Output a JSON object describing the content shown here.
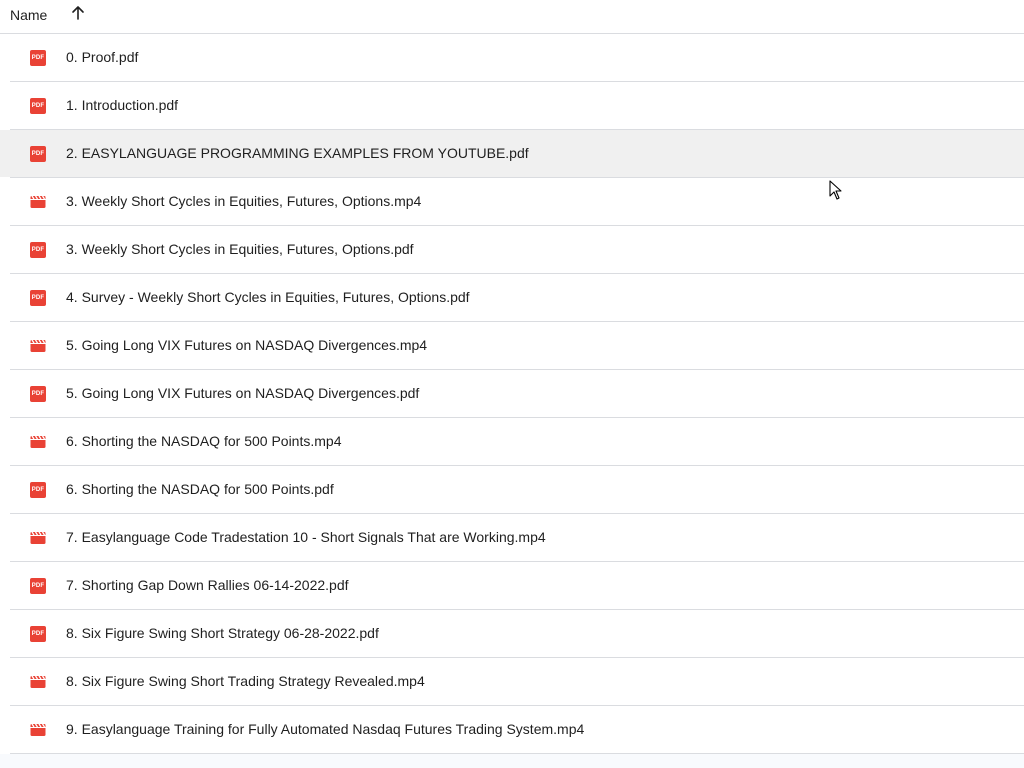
{
  "header": {
    "name_label": "Name",
    "sort": "ascending"
  },
  "colors": {
    "pdf_icon": "#e94235",
    "video_icon": "#e94235",
    "hover_row": "#f0f0f0",
    "divider": "#dadce0"
  },
  "files": [
    {
      "name": "0. Proof.pdf",
      "type": "pdf",
      "icon": "pdf-icon"
    },
    {
      "name": "1. Introduction.pdf",
      "type": "pdf",
      "icon": "pdf-icon"
    },
    {
      "name": "2. EASYLANGUAGE PROGRAMMING EXAMPLES FROM YOUTUBE.pdf",
      "type": "pdf",
      "icon": "pdf-icon",
      "hovered": true
    },
    {
      "name": "3. Weekly Short Cycles in Equities, Futures, Options.mp4",
      "type": "video",
      "icon": "video-icon"
    },
    {
      "name": "3. Weekly Short Cycles in Equities, Futures, Options.pdf",
      "type": "pdf",
      "icon": "pdf-icon"
    },
    {
      "name": "4. Survey - Weekly Short Cycles in Equities, Futures, Options.pdf",
      "type": "pdf",
      "icon": "pdf-icon"
    },
    {
      "name": "5. Going Long VIX Futures on NASDAQ Divergences.mp4",
      "type": "video",
      "icon": "video-icon"
    },
    {
      "name": "5. Going Long VIX Futures on NASDAQ Divergences.pdf",
      "type": "pdf",
      "icon": "pdf-icon"
    },
    {
      "name": "6. Shorting the NASDAQ for 500 Points.mp4",
      "type": "video",
      "icon": "video-icon"
    },
    {
      "name": "6. Shorting the NASDAQ for 500 Points.pdf",
      "type": "pdf",
      "icon": "pdf-icon"
    },
    {
      "name": "7. Easylanguage Code Tradestation 10  - Short Signals That are Working.mp4",
      "type": "video",
      "icon": "video-icon"
    },
    {
      "name": "7. Shorting Gap Down Rallies 06-14-2022.pdf",
      "type": "pdf",
      "icon": "pdf-icon"
    },
    {
      "name": "8. Six Figure Swing Short Strategy 06-28-2022.pdf",
      "type": "pdf",
      "icon": "pdf-icon"
    },
    {
      "name": "8. Six Figure Swing Short Trading Strategy Revealed.mp4",
      "type": "video",
      "icon": "video-icon"
    },
    {
      "name": "9. Easylanguage Training for Fully Automated Nasdaq Futures Trading System.mp4",
      "type": "video",
      "icon": "video-icon"
    }
  ],
  "pdf_icon_label": "PDF"
}
